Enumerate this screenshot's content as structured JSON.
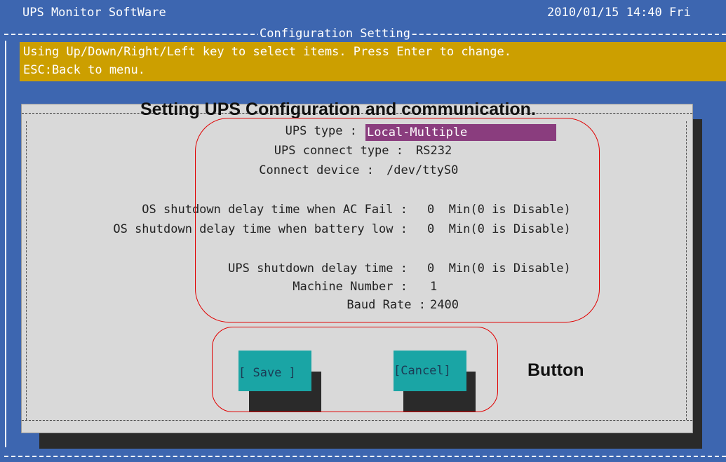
{
  "header": {
    "app_title": "UPS Monitor SoftWare",
    "datetime": "2010/01/15 14:40 Fri"
  },
  "section": {
    "title": "Configuration Setting"
  },
  "help": {
    "line1": "Using Up/Down/Right/Left key to select items. Press Enter to change.",
    "line2": "ESC:Back to menu."
  },
  "fields": [
    {
      "label": "UPS type :",
      "value": "Local-Multiple"
    },
    {
      "label": "UPS connect type :",
      "value": "RS232"
    },
    {
      "label": "Connect device :",
      "value": "/dev/ttyS0"
    },
    {
      "label": "OS shutdown delay time when AC Fail :",
      "value": "0  Min(0 is Disable)"
    },
    {
      "label": "OS shutdown delay time when battery low :",
      "value": "0  Min(0 is Disable)"
    },
    {
      "label": "UPS shutdown delay time :",
      "value": "0  Min(0 is Disable)"
    },
    {
      "label": "Machine Number :",
      "value": "1"
    },
    {
      "label": "Baud Rate :",
      "value": "2400"
    }
  ],
  "buttons": {
    "save": "[ Save ]",
    "cancel": "[Cancel]"
  },
  "annotations": {
    "title": "Setting UPS Configuration and communication.",
    "button": "Button",
    "highlight_color": "#e00000"
  },
  "colors": {
    "screen_bg": "#3d66b0",
    "help_bg": "#cc9f00",
    "dialog_bg": "#d9d9d9",
    "selected_bg": "#8a3d7e",
    "button_bg": "#1aa5a5"
  }
}
